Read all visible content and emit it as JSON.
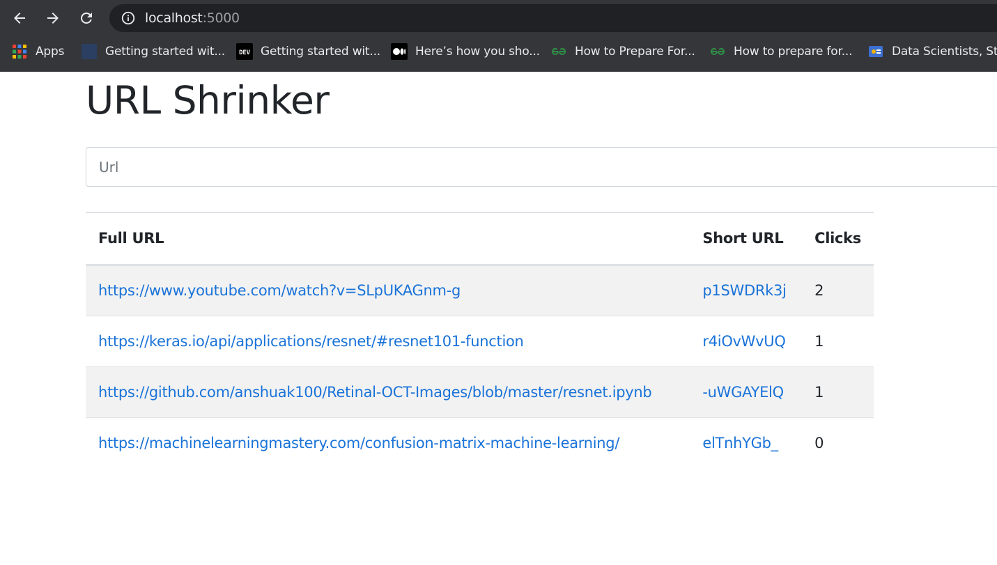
{
  "browser": {
    "address": {
      "host": "localhost",
      "port": ":5000"
    },
    "icons": {
      "back": "back-arrow-icon",
      "forward": "forward-arrow-icon",
      "reload": "reload-icon",
      "site_info": "info-icon"
    },
    "bookmarks": [
      {
        "label": "Apps",
        "icon": "apps-grid-icon"
      },
      {
        "label": "Getting started wit...",
        "icon": "blank-page-icon"
      },
      {
        "label": "Getting started wit...",
        "icon": "dev-logo-icon"
      },
      {
        "label": "Here’s how you sho...",
        "icon": "medium-logo-icon"
      },
      {
        "label": "How to Prepare For...",
        "icon": "gfg-logo-icon"
      },
      {
        "label": "How to prepare for...",
        "icon": "gfg-logo-icon"
      },
      {
        "label": "Data Scientists, Sta...",
        "icon": "site-icon"
      }
    ],
    "colors": {
      "chrome": "#35363a",
      "omnibox": "#202124"
    }
  },
  "page": {
    "title": "URL Shrinker",
    "url_input": {
      "placeholder": "Url",
      "value": ""
    },
    "table": {
      "headers": {
        "full": "Full URL",
        "short": "Short URL",
        "clicks": "Clicks"
      },
      "rows": [
        {
          "full": "https://www.youtube.com/watch?v=SLpUKAGnm-g",
          "short": "p1SWDRk3j",
          "clicks": "2"
        },
        {
          "full": "https://keras.io/api/applications/resnet/#resnet101-function",
          "short": "r4iOvWvUQ",
          "clicks": "1"
        },
        {
          "full": "https://github.com/anshuak100/Retinal-OCT-Images/blob/master/resnet.ipynb",
          "short": "-uWGAYElQ",
          "clicks": "1"
        },
        {
          "full": "https://machinelearningmastery.com/confusion-matrix-machine-learning/",
          "short": "elTnhYGb_",
          "clicks": "0"
        }
      ]
    },
    "colors": {
      "link": "#1a73d9",
      "stripe": "#f2f2f2",
      "border": "#dee2e6"
    }
  }
}
